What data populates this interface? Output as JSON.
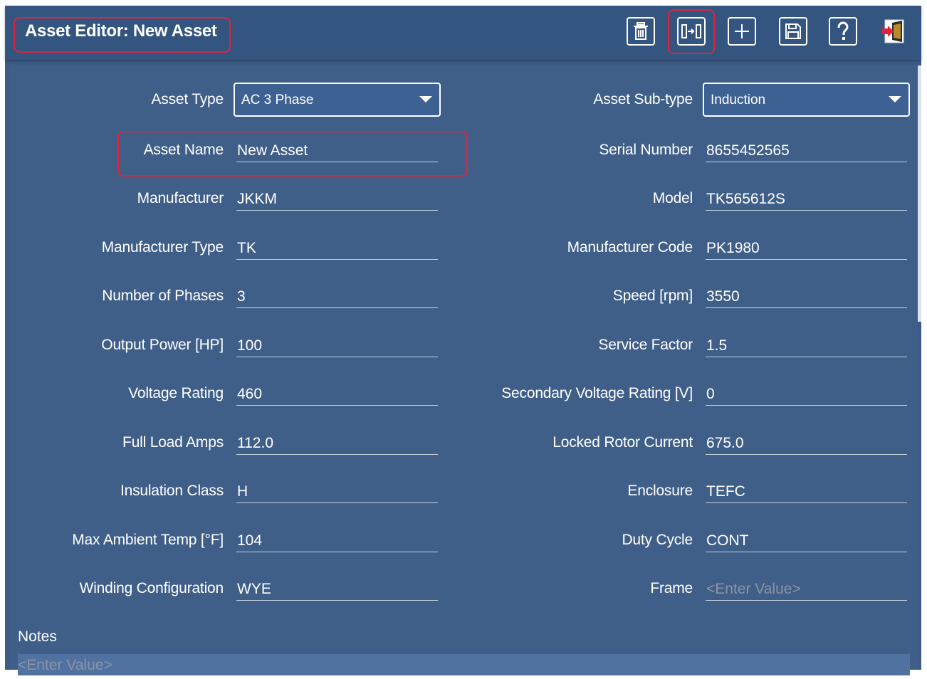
{
  "header": {
    "title": "Asset Editor: New Asset",
    "toolbar": [
      {
        "name": "delete-button",
        "icon": "trash-icon"
      },
      {
        "name": "export-button",
        "icon": "export-icon"
      },
      {
        "name": "add-button",
        "icon": "plus-icon"
      },
      {
        "name": "save-button",
        "icon": "save-icon"
      },
      {
        "name": "help-button",
        "icon": "help-icon"
      },
      {
        "name": "exit-button",
        "icon": "exit-icon"
      }
    ]
  },
  "form": {
    "asset_type": {
      "label": "Asset Type",
      "value": "AC 3 Phase"
    },
    "asset_subtype": {
      "label": "Asset Sub-type",
      "value": "Induction"
    },
    "left": [
      {
        "label": "Asset Name",
        "value": "New Asset"
      },
      {
        "label": "Manufacturer",
        "value": "JKKM"
      },
      {
        "label": "Manufacturer Type",
        "value": "TK"
      },
      {
        "label": "Number of Phases",
        "value": "3"
      },
      {
        "label": "Output Power [HP]",
        "value": "100"
      },
      {
        "label": "Voltage Rating",
        "value": "460"
      },
      {
        "label": "Full Load Amps",
        "value": "112.0"
      },
      {
        "label": "Insulation Class",
        "value": "H"
      },
      {
        "label": "Max Ambient Temp [°F]",
        "value": "104"
      },
      {
        "label": "Winding Configuration",
        "value": "WYE"
      }
    ],
    "right": [
      {
        "label": "Serial Number",
        "value": "8655452565"
      },
      {
        "label": "Model",
        "value": "TK565612S"
      },
      {
        "label": "Manufacturer Code",
        "value": "PK1980"
      },
      {
        "label": "Speed [rpm]",
        "value": "3550"
      },
      {
        "label": "Service Factor",
        "value": "1.5"
      },
      {
        "label": "Secondary Voltage Rating [V]",
        "value": "0"
      },
      {
        "label": "Locked Rotor Current",
        "value": "675.0"
      },
      {
        "label": "Enclosure",
        "value": "TEFC"
      },
      {
        "label": "Duty Cycle",
        "value": "CONT"
      },
      {
        "label": "Frame",
        "value": "",
        "placeholder": "<Enter Value>"
      }
    ],
    "notes": {
      "label": "Notes",
      "placeholder": "<Enter Value>"
    }
  },
  "colors": {
    "background": "#3c5c86",
    "header": "#335580",
    "highlight": "#e0233a"
  }
}
